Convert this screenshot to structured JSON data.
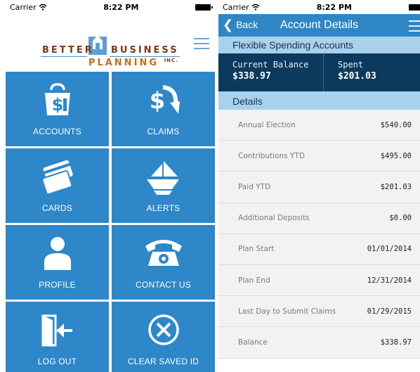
{
  "left_screen": {
    "status": {
      "carrier": "Carrier",
      "time": "8:22 PM"
    },
    "logo": {
      "word1": "BETTER",
      "word2": "BUSINESS",
      "word3": "PLANNING",
      "suffix": "INC."
    },
    "tiles": [
      {
        "label": "ACCOUNTS",
        "icon": "money-bag-icon"
      },
      {
        "label": "CLAIMS",
        "icon": "dollar-arrow-icon"
      },
      {
        "label": "CARDS",
        "icon": "credit-cards-icon"
      },
      {
        "label": "ALERTS",
        "icon": "paper-plane-icon"
      },
      {
        "label": "PROFILE",
        "icon": "person-icon"
      },
      {
        "label": "CONTACT US",
        "icon": "telephone-icon"
      },
      {
        "label": "LOG OUT",
        "icon": "logout-door-icon"
      },
      {
        "label": "CLEAR SAVED ID",
        "icon": "circle-x-icon"
      }
    ]
  },
  "right_screen": {
    "status": {
      "carrier": "Carrier",
      "time": "8:22 PM"
    },
    "nav": {
      "back_label": "Back",
      "title": "Account Details"
    },
    "section_title": "Flexible Spending Accounts",
    "balance": {
      "current_label": "Current Balance",
      "current_value": "$338.97",
      "spent_label": "Spent",
      "spent_value": "$201.03"
    },
    "details_title": "Details",
    "details": [
      {
        "key": "Annual Election",
        "value": "$540.00"
      },
      {
        "key": "Contributions YTD",
        "value": "$495.00"
      },
      {
        "key": "Paid YTD",
        "value": "$201.03"
      },
      {
        "key": "Additional Deposits",
        "value": "$0.00"
      },
      {
        "key": "Plan Start",
        "value": "01/01/2014"
      },
      {
        "key": "Plan End",
        "value": "12/31/2014"
      },
      {
        "key": "Last Day to Submit Claims",
        "value": "01/29/2015"
      },
      {
        "key": "Balance",
        "value": "$338.97"
      }
    ]
  },
  "colors": {
    "tile_blue": "#2e87c8",
    "navbar_blue": "#2f86c5",
    "light_band": "#a9d1ec",
    "balance_navy": "#0b3a5c",
    "brand_brown": "#7a3a1a",
    "brand_orange": "#c2701e"
  }
}
